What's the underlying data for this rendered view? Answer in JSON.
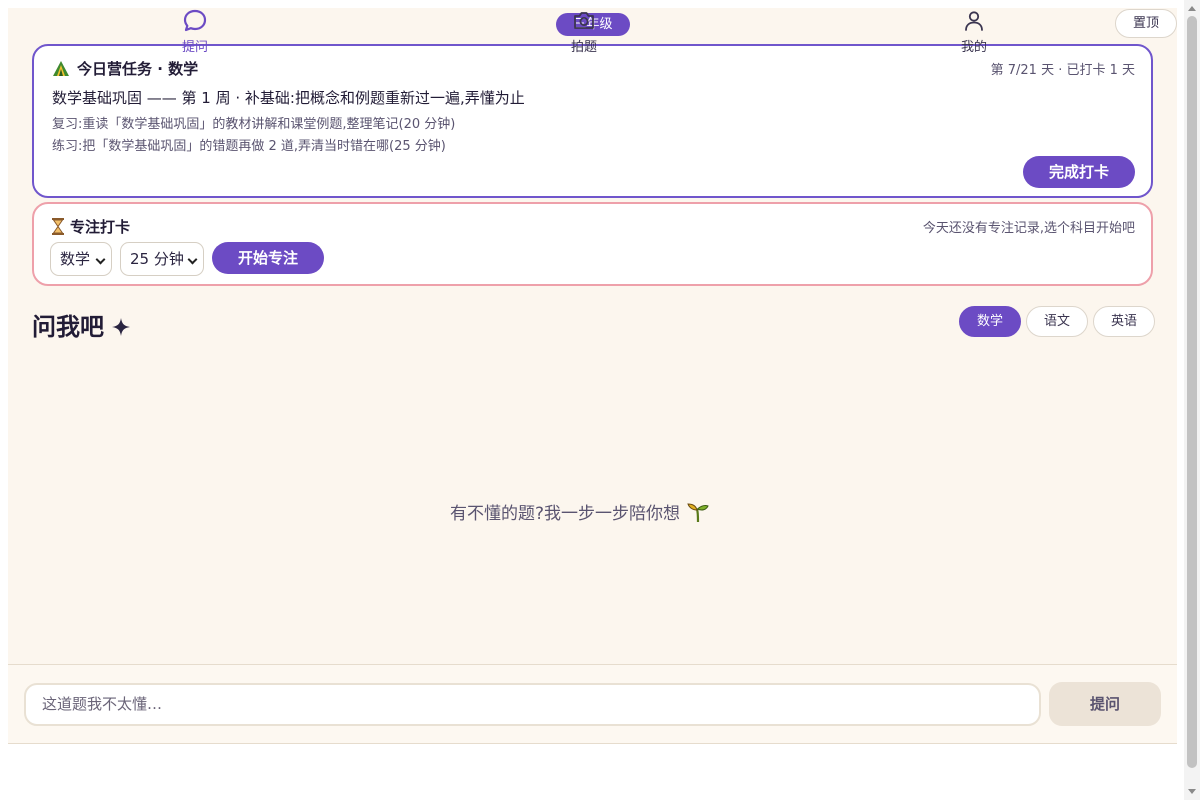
{
  "header": {
    "grade": "三年级",
    "pin_label": "置顶"
  },
  "task": {
    "heading": "今日营任务 · 数学",
    "progress": "第 7/21 天 · 已打卡 1 天",
    "title": "数学基础巩固 —— 第 1 周 · 补基础:把概念和例题重新过一遍,弄懂为止",
    "review": "复习:重读「数学基础巩固」的教材讲解和课堂例题,整理笔记(20 分钟)",
    "practice": "练习:把「数学基础巩固」的错题再做 2 道,弄清当时错在哪(25 分钟)",
    "done_label": "完成打卡"
  },
  "focus": {
    "heading": "专注打卡",
    "hint": "今天还没有专注记录,选个科目开始吧",
    "subject_selected": "数学",
    "duration_selected": "25 分钟",
    "start_label": "开始专注"
  },
  "ask": {
    "title": "问我吧",
    "subjects": [
      "数学",
      "语文",
      "英语"
    ],
    "active_subject": "数学",
    "empty_text": "有不懂的题?我一步一步陪你想"
  },
  "input": {
    "placeholder": "这道题我不太懂…",
    "submit_label": "提问"
  },
  "nav": {
    "items": [
      {
        "label": "提问",
        "icon": "chat-bubble-icon",
        "active": true
      },
      {
        "label": "拍题",
        "icon": "camera-icon",
        "active": false
      },
      {
        "label": "我的",
        "icon": "user-icon",
        "active": false
      }
    ]
  },
  "colors": {
    "accent": "#6c4bc4",
    "background": "#fcf6ee",
    "task_border": "#7056cc",
    "focus_border": "#eea0aa"
  }
}
